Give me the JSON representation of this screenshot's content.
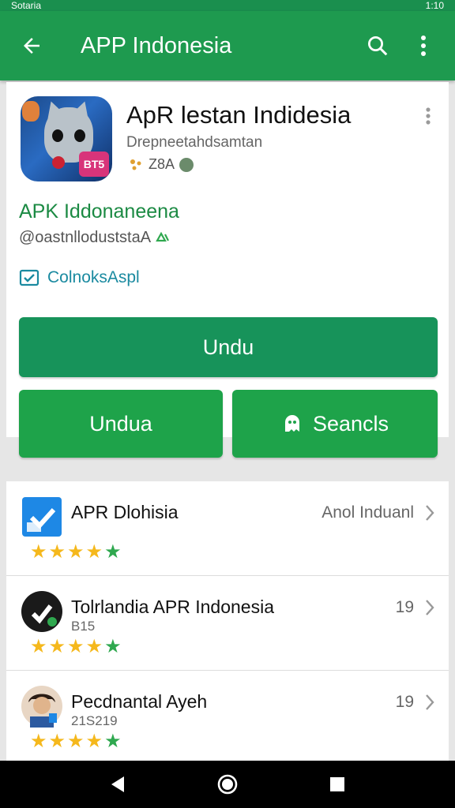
{
  "status_bar": {
    "left_text": "Sotaria",
    "right_text": "1:10"
  },
  "app_bar": {
    "title": "APP Indonesia"
  },
  "app": {
    "name": "ApR lestan Indidesia",
    "developer": "Drepneetahdsamtan",
    "rating_text": "Z8A",
    "icon_tag": "BT5",
    "subtitle": "APK Iddonaneena",
    "handle": "@oastnlloduststaA",
    "check_label": "ColnoksAspl"
  },
  "buttons": {
    "main": "Undu",
    "secondary_left": "Undua",
    "secondary_right": "Seancls"
  },
  "list": [
    {
      "title": "APR Dlohisia",
      "subtitle": "",
      "side": "Anol Induanl",
      "rating": 4.5,
      "icon": "checkbox-app-icon"
    },
    {
      "title": "Tolrlandia APR Indonesia",
      "subtitle": "B15",
      "side": "19",
      "rating": 4.5,
      "icon": "dark-logo-icon"
    },
    {
      "title": "Pecdnantal Ayeh",
      "subtitle": "21S219",
      "side": "19",
      "rating": 4.5,
      "icon": "avatar-icon"
    }
  ],
  "colors": {
    "primary": "#1e9a4f",
    "accent_text": "#1b8a43",
    "link": "#1a8aa0",
    "star": "#f5b81c",
    "star_last": "#2fa84f"
  }
}
